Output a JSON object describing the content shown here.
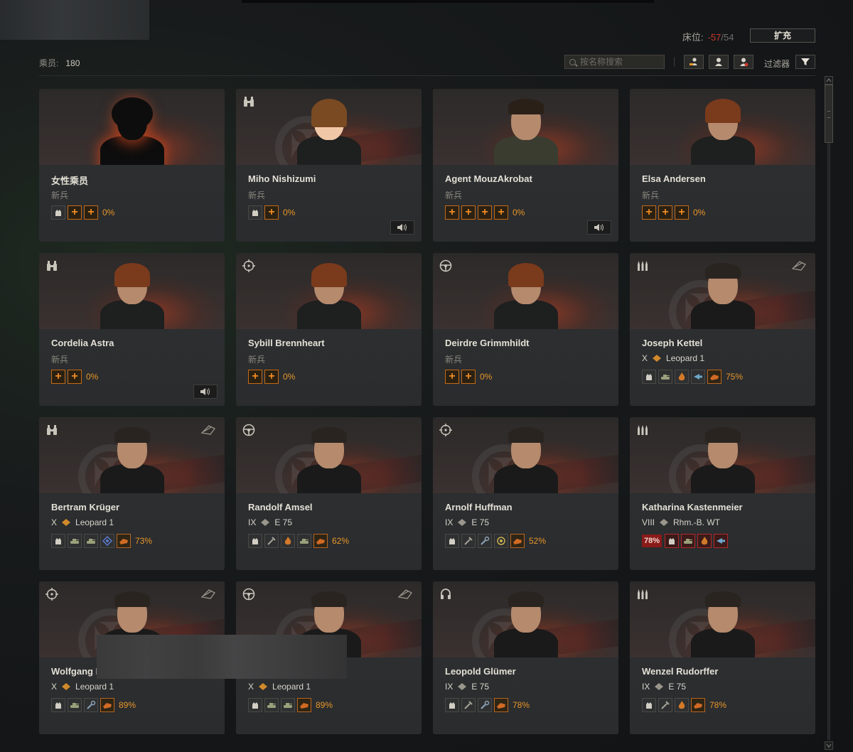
{
  "header": {
    "crew_label": "乘员:",
    "crew_count": "180",
    "berth_label": "床位:",
    "berth_used": "-57",
    "berth_sep": "/",
    "berth_total": "54",
    "expand_label": "扩充"
  },
  "toolbar": {
    "search_placeholder": "按名称搜索",
    "filter_label": "过滤器"
  },
  "colors": {
    "accent": "#e8962a",
    "danger": "#c83a2a",
    "new_skill": "#f08a22"
  },
  "crew": [
    {
      "name": "女性乘员",
      "sub": "新兵",
      "role": "none",
      "portrait": "silhouette",
      "skills": [
        "brotherhood-icon",
        "new",
        "new"
      ],
      "pct": "0%"
    },
    {
      "name": "Miho Nishizumi",
      "sub": "新兵",
      "role": "binoculars-icon",
      "portrait": "anime",
      "skills": [
        "brotherhood-icon",
        "new"
      ],
      "pct": "0%",
      "voice": true
    },
    {
      "name": "Agent MouzAkrobat",
      "sub": "新兵",
      "role": "none",
      "portrait": "man",
      "skills": [
        "new",
        "new",
        "new",
        "new"
      ],
      "pct": "0%",
      "voice": true
    },
    {
      "name": "Elsa Andersen",
      "sub": "新兵",
      "role": "none",
      "portrait": "woman",
      "skills": [
        "new",
        "new",
        "new"
      ],
      "pct": "0%"
    },
    {
      "name": "Cordelia Astra",
      "sub": "新兵",
      "role": "binoculars-icon",
      "portrait": "woman",
      "skills": [
        "new",
        "new"
      ],
      "pct": "0%",
      "voice": true
    },
    {
      "name": "Sybill Brennheart",
      "sub": "新兵",
      "role": "crosshair-icon",
      "portrait": "woman",
      "skills": [
        "new",
        "new"
      ],
      "pct": "0%"
    },
    {
      "name": "Deirdre Grimmhildt",
      "sub": "新兵",
      "role": "steering-wheel-icon",
      "portrait": "woman",
      "skills": [
        "new",
        "new"
      ],
      "pct": "0%"
    },
    {
      "name": "Joseph Kettel",
      "tier": "X",
      "tank": "Leopard 1",
      "role": "shells-icon",
      "spec": true,
      "portrait": "soldier",
      "skills": [
        "brotherhood-icon",
        "tank-skill-icon",
        "fire-icon",
        "arrow-skill-icon",
        "active"
      ],
      "pct": "75%"
    },
    {
      "name": "Bertram Krüger",
      "tier": "X",
      "tank": "Leopard 1",
      "role": "binoculars-icon",
      "spec": true,
      "portrait": "soldier",
      "skills": [
        "brotherhood-icon",
        "tank-skill-icon",
        "tank-skill-icon",
        "radio-skill-icon",
        "active"
      ],
      "pct": "73%"
    },
    {
      "name": "Randolf Amsel",
      "tier": "IX",
      "tank": "E 75",
      "role": "steering-wheel-icon",
      "portrait": "soldier",
      "skills": [
        "brotherhood-icon",
        "repair-icon",
        "fire-icon",
        "tank-skill-icon",
        "active"
      ],
      "pct": "62%"
    },
    {
      "name": "Arnolf Huffman",
      "tier": "IX",
      "tank": "E 75",
      "role": "crosshair-icon",
      "portrait": "soldier",
      "skills": [
        "brotherhood-icon",
        "repair-icon",
        "wrench-icon",
        "target-skill-icon",
        "active"
      ],
      "pct": "52%"
    },
    {
      "name": "Katharina Kastenmeier",
      "tier": "VIII",
      "tank": "Rhm.-B. WT",
      "role": "shells-icon",
      "portrait": "soldier",
      "pct_first": "78%",
      "skills": [
        "brotherhood-icon",
        "tank-skill-icon",
        "fire-icon",
        "arrow-skill-icon"
      ],
      "pct": ""
    },
    {
      "name": "Wolfgang Mö",
      "tier": "X",
      "tank": "Leopard 1",
      "role": "crosshair-icon",
      "spec": true,
      "portrait": "soldier",
      "skills": [
        "brotherhood-icon",
        "tank-skill-icon",
        "wrench-icon",
        "active"
      ],
      "pct": "89%"
    },
    {
      "name": "",
      "tier": "X",
      "tank": "Leopard 1",
      "role": "steering-wheel-icon",
      "spec": true,
      "portrait": "soldier",
      "skills": [
        "brotherhood-icon",
        "tank-skill-icon",
        "tank-skill-icon",
        "active"
      ],
      "pct": "89%"
    },
    {
      "name": "Leopold Glümer",
      "tier": "IX",
      "tank": "E 75",
      "role": "headphones-icon",
      "portrait": "soldier",
      "skills": [
        "brotherhood-icon",
        "repair-icon",
        "wrench-icon",
        "active"
      ],
      "pct": "78%"
    },
    {
      "name": "Wenzel Rudorffer",
      "tier": "IX",
      "tank": "E 75",
      "role": "shells-icon",
      "portrait": "soldier",
      "skills": [
        "brotherhood-icon",
        "repair-icon",
        "fire-icon",
        "active"
      ],
      "pct": "78%"
    }
  ]
}
